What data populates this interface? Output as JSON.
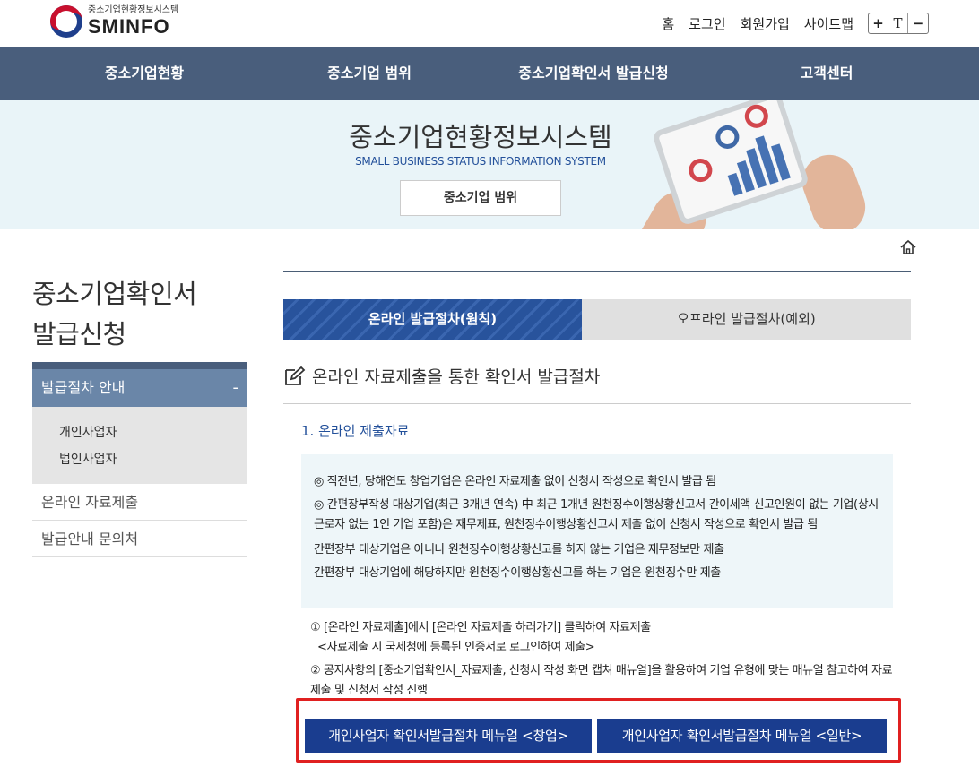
{
  "header": {
    "logo_sub": "중소기업현황정보시스템",
    "logo_main": "SMINFO",
    "util": [
      "홈",
      "로그인",
      "회원가입",
      "사이트맵"
    ],
    "font_controls": [
      "+",
      "T",
      "−"
    ]
  },
  "gnb": [
    "중소기업현황",
    "중소기업 범위",
    "중소기업확인서 발급신청",
    "고객센터"
  ],
  "banner": {
    "title": "중소기업현황정보시스템",
    "subtitle": "SMALL BUSINESS STATUS INFORMATION SYSTEM",
    "button": "중소기업 범위"
  },
  "sidebar": {
    "title_line1": "중소기업확인서",
    "title_line2": "발급신청",
    "head": "발급절차 안내",
    "head_toggle": "-",
    "sub_items": [
      "개인사업자",
      "법인사업자"
    ],
    "items": [
      "온라인 자료제출",
      "발급안내 문의처"
    ]
  },
  "tabs": {
    "active": "온라인 발급절차(원칙)",
    "inactive": "오프라인 발급절차(예외)"
  },
  "section": {
    "title": "온라인 자료제출을 통한 확인서 발급절차",
    "sub_title": "1. 온라인 제출자료"
  },
  "info_box": {
    "line1": "◎ 직전년, 당해연도 창업기업은 온라인 자료제출 없이 신청서 작성으로 확인서 발급 됨",
    "line2a": "◎ 간편장부작성 대상기업(최근 3개년 연속) 中 최근 1개년 원천징수이행상황신고서 간이세액 신고인원이 없는 기업(상시",
    "line2b": "근로자 없는 1인 기업 포함)은 재무제표, 원천징수이행상황신고서 제출 없이 신청서 작성으로 확인서 발급 됨",
    "line3": "간편장부 대상기업은 아니나 원천징수이행상황신고를 하지 않는 기업은 재무정보만 제출",
    "line4": "간편장부 대상기업에 해당하지만 원천징수이행상황신고를 하는 기업은 원천징수만 제출"
  },
  "steps": {
    "step1": "① [온라인 자료제출]에서 [온라인 자료제출 하러가기] 클릭하여 자료제출",
    "step1_note": "<자료제출 시 국세청에 등록된 인증서로 로그인하여 제출>",
    "step2a": "② 공지사항의 [중소기업확인서_자료제출, 신청서 작성 화면 캡쳐 매뉴얼]을 활용하여 기업 유형에 맞는 매뉴얼 참고하여 자료",
    "step2b": "제출 및 신청서 작성 진행"
  },
  "buttons": {
    "manual_startup": "개인사업자 확인서발급절차 메뉴얼 <창업>",
    "manual_general": "개인사업자 확인서발급절차 메뉴얼 <일반>"
  }
}
